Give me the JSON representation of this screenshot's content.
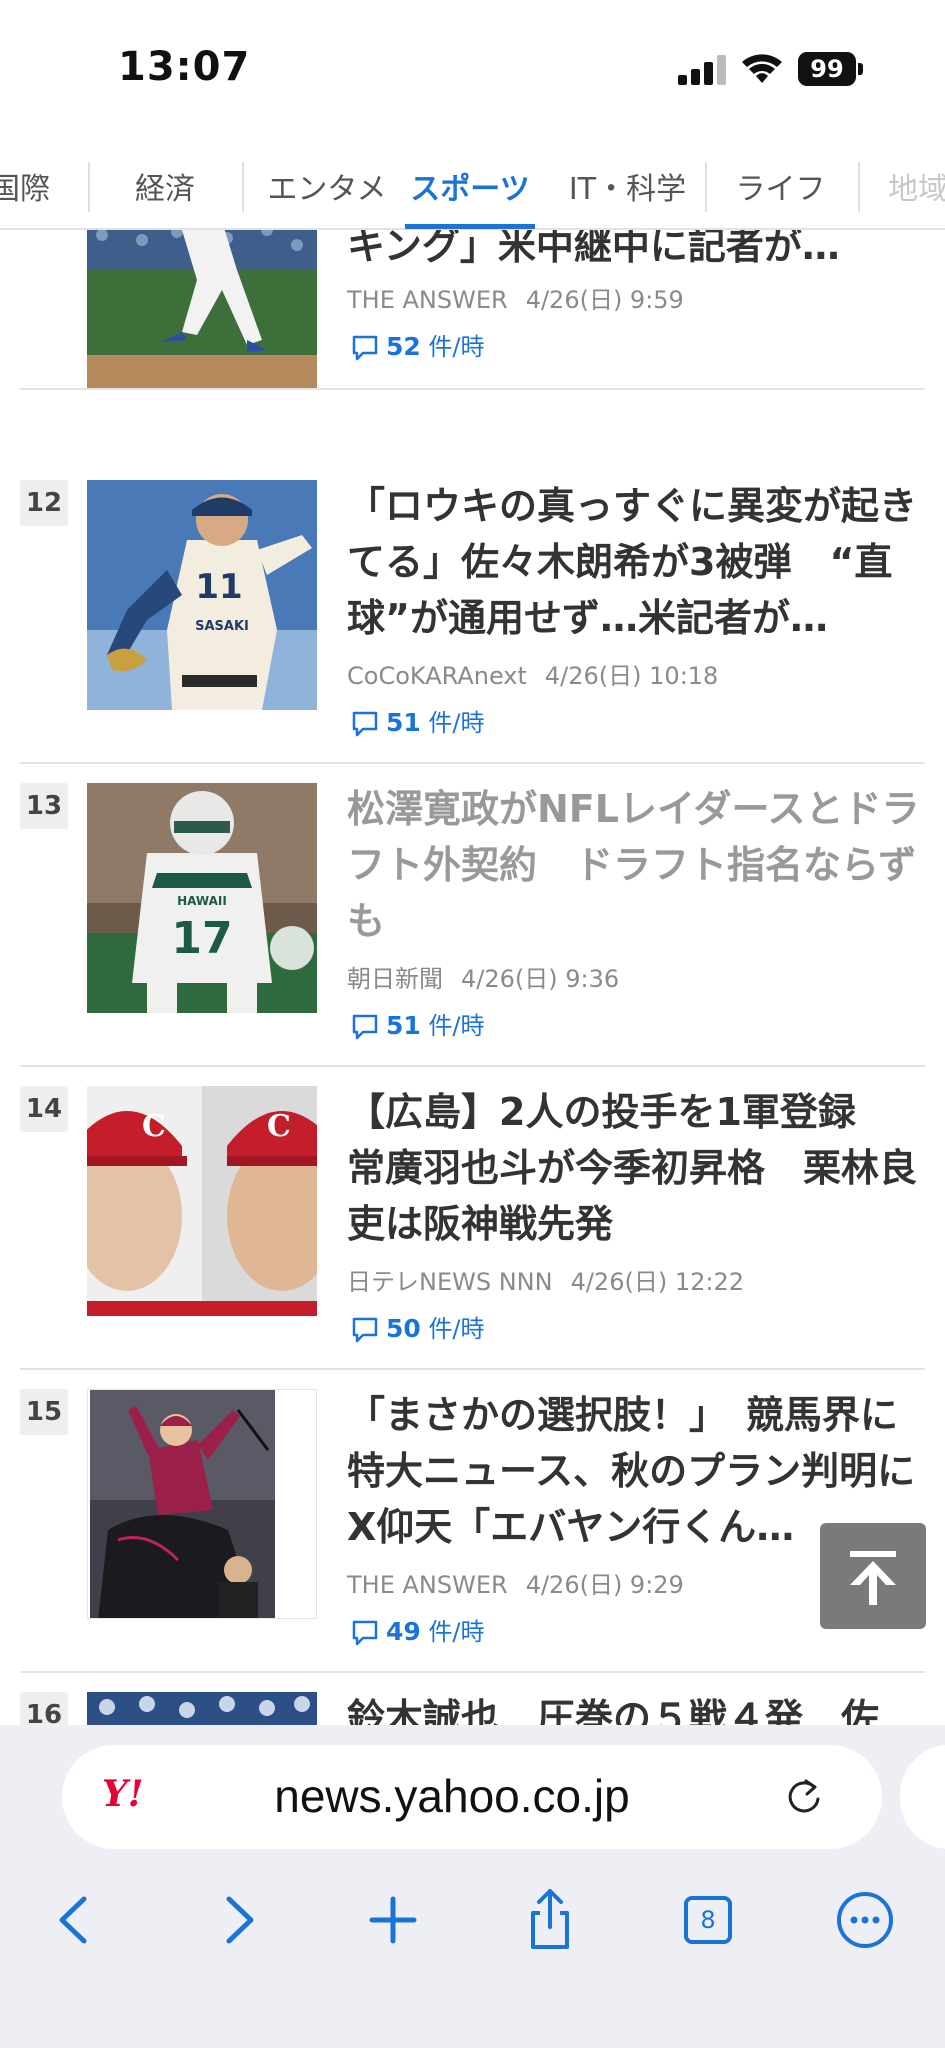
{
  "status": {
    "time": "13:07",
    "battery": "99"
  },
  "tabs": [
    {
      "label": "国際"
    },
    {
      "label": "経済"
    },
    {
      "label": "エンタメ"
    },
    {
      "label": "スポーツ"
    },
    {
      "label": "IT・科学"
    },
    {
      "label": "ライフ"
    },
    {
      "label": "地域"
    }
  ],
  "articles": [
    {
      "rank": "",
      "headline": "ュース　「これは正真正銘ショッキング」米中継中に記者が…",
      "source": "THE ANSWER",
      "date": "4/26(日) 9:59",
      "comments": "52",
      "comments_unit": "件/時",
      "read": false
    },
    {
      "rank": "12",
      "headline": "「ロウキの真っすぐに異変が起きてる」佐々木朗希が3被弾　“直球”が通用せず…米記者が…",
      "source": "CoCoKARAnext",
      "date": "4/26(日) 10:18",
      "comments": "51",
      "comments_unit": "件/時",
      "read": false
    },
    {
      "rank": "13",
      "headline": "松澤寛政がNFLレイダースとドラフト外契約　ドラフト指名ならずも",
      "source": "朝日新聞",
      "date": "4/26(日) 9:36",
      "comments": "51",
      "comments_unit": "件/時",
      "read": true
    },
    {
      "rank": "14",
      "headline": "【広島】2人の投手を1軍登録　常廣羽也斗が今季初昇格　栗林良吏は阪神戦先発",
      "source": "日テレNEWS NNN",
      "date": "4/26(日) 12:22",
      "comments": "50",
      "comments_unit": "件/時",
      "read": false
    },
    {
      "rank": "15",
      "headline": "「まさかの選択肢！」　競馬界に特大ニュース、秋のプラン判明にX仰天「エバヤン行くん…",
      "source": "THE ANSWER",
      "date": "4/26(日) 9:29",
      "comments": "49",
      "comments_unit": "件/時",
      "read": false
    },
    {
      "rank": "16",
      "headline": "鈴木誠也　圧巻の５戦４発　佐",
      "source": "",
      "date": "",
      "comments": "",
      "comments_unit": "",
      "read": false
    }
  ],
  "jersey_texts": {
    "a11": "11",
    "a11_name": "SASAKI",
    "a13": "17",
    "a13_team": "HAWAII"
  },
  "browser": {
    "logo": "Y!",
    "url": "news.yahoo.co.jp",
    "tab_count": "8"
  },
  "colors": {
    "accent": "#1a73d9",
    "brand": "#e60033"
  }
}
